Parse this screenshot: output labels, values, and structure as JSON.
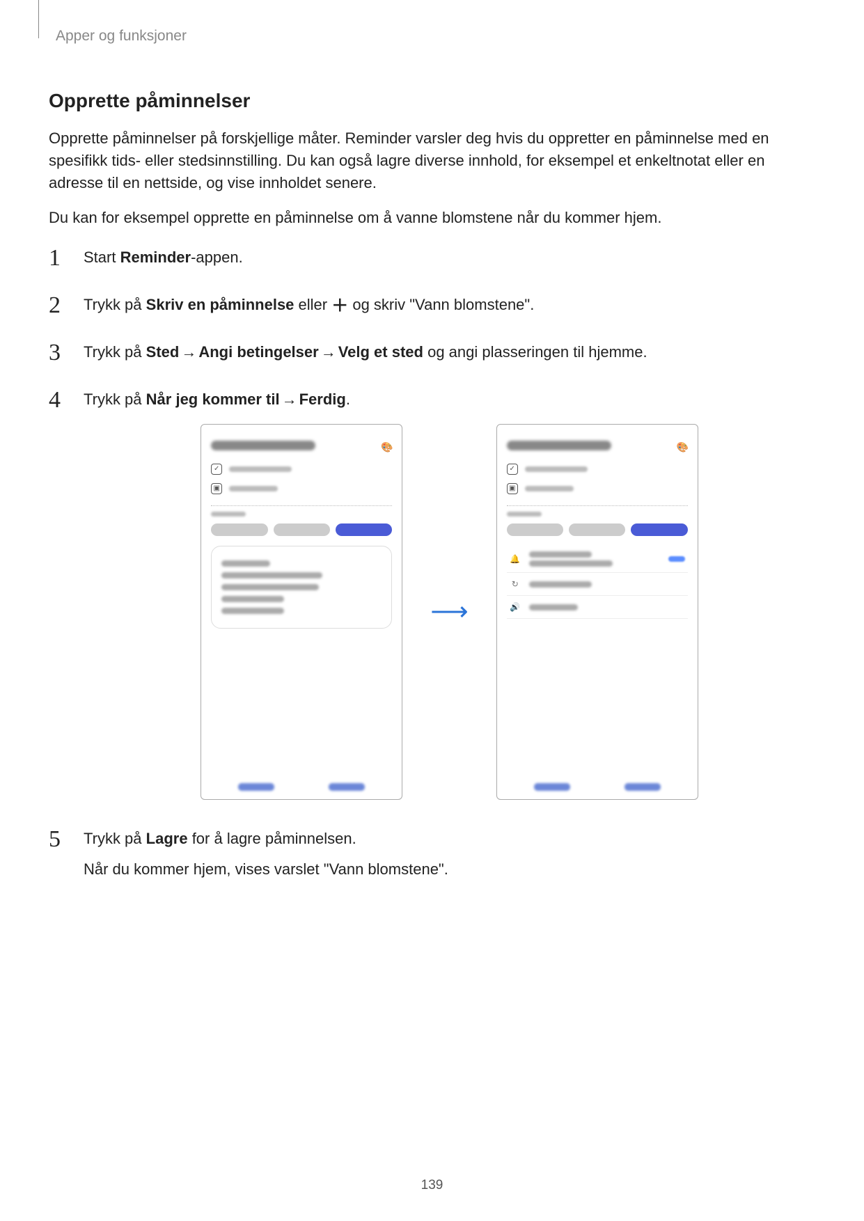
{
  "breadcrumb": "Apper og funksjoner",
  "section_title": "Opprette påminnelser",
  "para1": "Opprette påminnelser på forskjellige måter. Reminder varsler deg hvis du oppretter en påminnelse med en spesifikk tids- eller stedsinnstilling. Du kan også lagre diverse innhold, for eksempel et enkeltnotat eller en adresse til en nettside, og vise innholdet senere.",
  "para2": "Du kan for eksempel opprette en påminnelse om å vanne blomstene når du kommer hjem.",
  "steps": {
    "s1_a": "Start ",
    "s1_b": "Reminder",
    "s1_c": "-appen.",
    "s2_a": "Trykk på ",
    "s2_b": "Skriv en påminnelse",
    "s2_c": " eller ",
    "s2_d": " og skriv \"Vann blomstene\".",
    "s3_a": "Trykk på ",
    "s3_b": "Sted",
    "s3_arrow": " → ",
    "s3_c": "Angi betingelser",
    "s3_d": "Velg et sted",
    "s3_e": " og angi plasseringen til hjemme.",
    "s4_a": "Trykk på ",
    "s4_b": "Når jeg kommer til",
    "s4_c": "Ferdig",
    "s4_d": ".",
    "s5_a": "Trykk på ",
    "s5_b": "Lagre",
    "s5_c": " for å lagre påminnelsen.",
    "s5_sub": "Når du kommer hjem, vises varslet \"Vann blomstene\"."
  },
  "page_number": "139"
}
